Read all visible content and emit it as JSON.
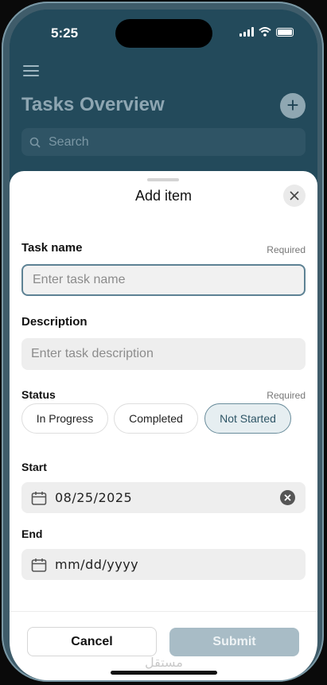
{
  "status_bar": {
    "time": "5:25"
  },
  "header": {
    "title": "Tasks Overview",
    "add_icon": "plus-icon",
    "search": {
      "placeholder": "Search"
    }
  },
  "sheet": {
    "title": "Add item",
    "close_icon": "close-icon",
    "task_name": {
      "label": "Task name",
      "required": "Required",
      "placeholder": "Enter task name",
      "value": ""
    },
    "description": {
      "label": "Description",
      "placeholder": "Enter task description",
      "value": ""
    },
    "status": {
      "label": "Status",
      "required": "Required",
      "options": [
        "In Progress",
        "Completed",
        "Not Started"
      ],
      "selected": "Not Started"
    },
    "start": {
      "label": "Start",
      "value": "08/25/2025"
    },
    "end": {
      "label": "End",
      "value": "mm/dd/yyyy"
    },
    "cancel_label": "Cancel",
    "submit_label": "Submit"
  },
  "watermark": "مستقل",
  "colors": {
    "header": "#234a5b",
    "accent": "#5d8294",
    "submit_disabled": "#a8bcc6",
    "chip_active": "#e6eef1"
  }
}
